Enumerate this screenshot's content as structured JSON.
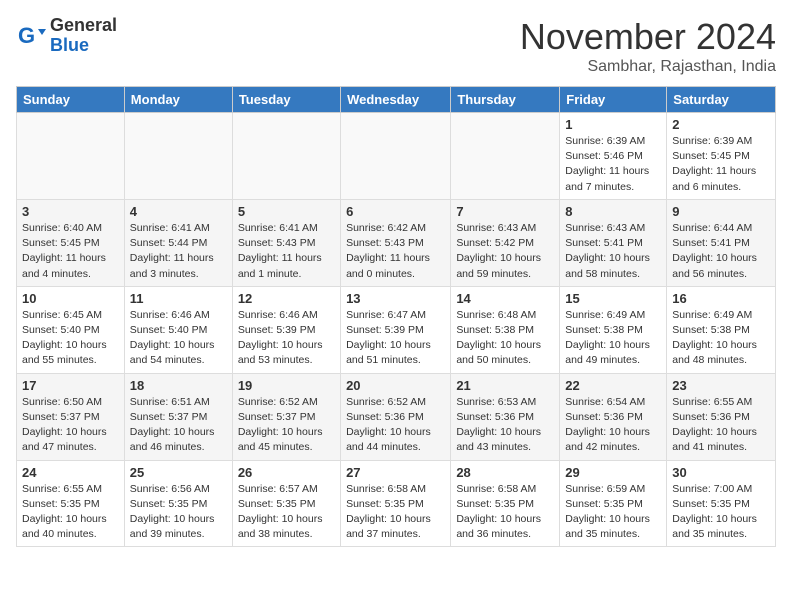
{
  "header": {
    "logo_general": "General",
    "logo_blue": "Blue",
    "month_title": "November 2024",
    "location": "Sambhar, Rajasthan, India"
  },
  "days_of_week": [
    "Sunday",
    "Monday",
    "Tuesday",
    "Wednesday",
    "Thursday",
    "Friday",
    "Saturday"
  ],
  "weeks": [
    [
      {
        "day": "",
        "info": ""
      },
      {
        "day": "",
        "info": ""
      },
      {
        "day": "",
        "info": ""
      },
      {
        "day": "",
        "info": ""
      },
      {
        "day": "",
        "info": ""
      },
      {
        "day": "1",
        "info": "Sunrise: 6:39 AM\nSunset: 5:46 PM\nDaylight: 11 hours and 7 minutes."
      },
      {
        "day": "2",
        "info": "Sunrise: 6:39 AM\nSunset: 5:45 PM\nDaylight: 11 hours and 6 minutes."
      }
    ],
    [
      {
        "day": "3",
        "info": "Sunrise: 6:40 AM\nSunset: 5:45 PM\nDaylight: 11 hours and 4 minutes."
      },
      {
        "day": "4",
        "info": "Sunrise: 6:41 AM\nSunset: 5:44 PM\nDaylight: 11 hours and 3 minutes."
      },
      {
        "day": "5",
        "info": "Sunrise: 6:41 AM\nSunset: 5:43 PM\nDaylight: 11 hours and 1 minute."
      },
      {
        "day": "6",
        "info": "Sunrise: 6:42 AM\nSunset: 5:43 PM\nDaylight: 11 hours and 0 minutes."
      },
      {
        "day": "7",
        "info": "Sunrise: 6:43 AM\nSunset: 5:42 PM\nDaylight: 10 hours and 59 minutes."
      },
      {
        "day": "8",
        "info": "Sunrise: 6:43 AM\nSunset: 5:41 PM\nDaylight: 10 hours and 58 minutes."
      },
      {
        "day": "9",
        "info": "Sunrise: 6:44 AM\nSunset: 5:41 PM\nDaylight: 10 hours and 56 minutes."
      }
    ],
    [
      {
        "day": "10",
        "info": "Sunrise: 6:45 AM\nSunset: 5:40 PM\nDaylight: 10 hours and 55 minutes."
      },
      {
        "day": "11",
        "info": "Sunrise: 6:46 AM\nSunset: 5:40 PM\nDaylight: 10 hours and 54 minutes."
      },
      {
        "day": "12",
        "info": "Sunrise: 6:46 AM\nSunset: 5:39 PM\nDaylight: 10 hours and 53 minutes."
      },
      {
        "day": "13",
        "info": "Sunrise: 6:47 AM\nSunset: 5:39 PM\nDaylight: 10 hours and 51 minutes."
      },
      {
        "day": "14",
        "info": "Sunrise: 6:48 AM\nSunset: 5:38 PM\nDaylight: 10 hours and 50 minutes."
      },
      {
        "day": "15",
        "info": "Sunrise: 6:49 AM\nSunset: 5:38 PM\nDaylight: 10 hours and 49 minutes."
      },
      {
        "day": "16",
        "info": "Sunrise: 6:49 AM\nSunset: 5:38 PM\nDaylight: 10 hours and 48 minutes."
      }
    ],
    [
      {
        "day": "17",
        "info": "Sunrise: 6:50 AM\nSunset: 5:37 PM\nDaylight: 10 hours and 47 minutes."
      },
      {
        "day": "18",
        "info": "Sunrise: 6:51 AM\nSunset: 5:37 PM\nDaylight: 10 hours and 46 minutes."
      },
      {
        "day": "19",
        "info": "Sunrise: 6:52 AM\nSunset: 5:37 PM\nDaylight: 10 hours and 45 minutes."
      },
      {
        "day": "20",
        "info": "Sunrise: 6:52 AM\nSunset: 5:36 PM\nDaylight: 10 hours and 44 minutes."
      },
      {
        "day": "21",
        "info": "Sunrise: 6:53 AM\nSunset: 5:36 PM\nDaylight: 10 hours and 43 minutes."
      },
      {
        "day": "22",
        "info": "Sunrise: 6:54 AM\nSunset: 5:36 PM\nDaylight: 10 hours and 42 minutes."
      },
      {
        "day": "23",
        "info": "Sunrise: 6:55 AM\nSunset: 5:36 PM\nDaylight: 10 hours and 41 minutes."
      }
    ],
    [
      {
        "day": "24",
        "info": "Sunrise: 6:55 AM\nSunset: 5:35 PM\nDaylight: 10 hours and 40 minutes."
      },
      {
        "day": "25",
        "info": "Sunrise: 6:56 AM\nSunset: 5:35 PM\nDaylight: 10 hours and 39 minutes."
      },
      {
        "day": "26",
        "info": "Sunrise: 6:57 AM\nSunset: 5:35 PM\nDaylight: 10 hours and 38 minutes."
      },
      {
        "day": "27",
        "info": "Sunrise: 6:58 AM\nSunset: 5:35 PM\nDaylight: 10 hours and 37 minutes."
      },
      {
        "day": "28",
        "info": "Sunrise: 6:58 AM\nSunset: 5:35 PM\nDaylight: 10 hours and 36 minutes."
      },
      {
        "day": "29",
        "info": "Sunrise: 6:59 AM\nSunset: 5:35 PM\nDaylight: 10 hours and 35 minutes."
      },
      {
        "day": "30",
        "info": "Sunrise: 7:00 AM\nSunset: 5:35 PM\nDaylight: 10 hours and 35 minutes."
      }
    ]
  ]
}
